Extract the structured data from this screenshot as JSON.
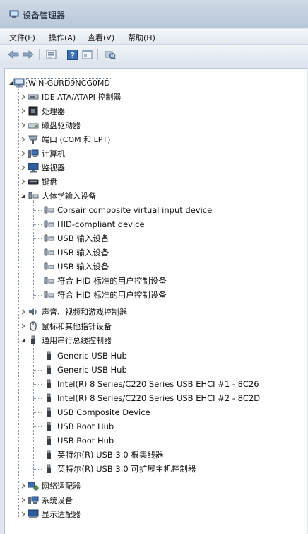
{
  "window": {
    "title": "设备管理器"
  },
  "menu": [
    "文件(F)",
    "操作(A)",
    "查看(V)",
    "帮助(H)"
  ],
  "toolbar": [
    {
      "name": "back-button",
      "icon": "arrow-left-icon"
    },
    {
      "name": "forward-button",
      "icon": "arrow-right-icon"
    },
    {
      "name": "properties-button",
      "icon": "properties-icon"
    },
    {
      "name": "help-button",
      "icon": "help-icon"
    },
    {
      "name": "view-button",
      "icon": "view-icon"
    },
    {
      "name": "scan-hardware-button",
      "icon": "scan-hardware-icon"
    }
  ],
  "tree": {
    "root": {
      "label": "WIN-GURD9NCG0MD",
      "icon": "computer-icon",
      "expanded": true
    },
    "categories": [
      {
        "label": "IDE ATA/ATAPI 控制器",
        "icon": "ide-controller-icon",
        "expanded": false
      },
      {
        "label": "处理器",
        "icon": "processor-icon",
        "expanded": false
      },
      {
        "label": "磁盘驱动器",
        "icon": "disk-drive-icon",
        "expanded": false
      },
      {
        "label": "端口 (COM 和 LPT)",
        "icon": "port-icon",
        "expanded": false
      },
      {
        "label": "计算机",
        "icon": "computer-icon",
        "expanded": false
      },
      {
        "label": "监视器",
        "icon": "monitor-icon",
        "expanded": false
      },
      {
        "label": "键盘",
        "icon": "keyboard-icon",
        "expanded": false
      },
      {
        "label": "人体学输入设备",
        "icon": "hid-icon",
        "expanded": true,
        "children": [
          "Corsair composite virtual input device",
          "HID-compliant device",
          "USB 输入设备",
          "USB 输入设备",
          "USB 输入设备",
          "符合 HID 标准的用户控制设备",
          "符合 HID 标准的用户控制设备"
        ]
      },
      {
        "label": "声音、视频和游戏控制器",
        "icon": "sound-icon",
        "expanded": false
      },
      {
        "label": "鼠标和其他指针设备",
        "icon": "mouse-icon",
        "expanded": false
      },
      {
        "label": "通用串行总线控制器",
        "icon": "usb-icon",
        "expanded": true,
        "children": [
          "Generic USB Hub",
          "Generic USB Hub",
          "Intel(R) 8 Series/C220 Series USB EHCI #1 - 8C26",
          "Intel(R) 8 Series/C220 Series USB EHCI #2 - 8C2D",
          "USB Composite Device",
          "USB Root Hub",
          "USB Root Hub",
          "英特尔(R) USB 3.0 根集线器",
          "英特尔(R) USB 3.0 可扩展主机控制器"
        ]
      },
      {
        "label": "网络适配器",
        "icon": "network-adapter-icon",
        "expanded": false
      },
      {
        "label": "系统设备",
        "icon": "system-device-icon",
        "expanded": false
      },
      {
        "label": "显示适配器",
        "icon": "display-adapter-icon",
        "expanded": false
      }
    ]
  }
}
